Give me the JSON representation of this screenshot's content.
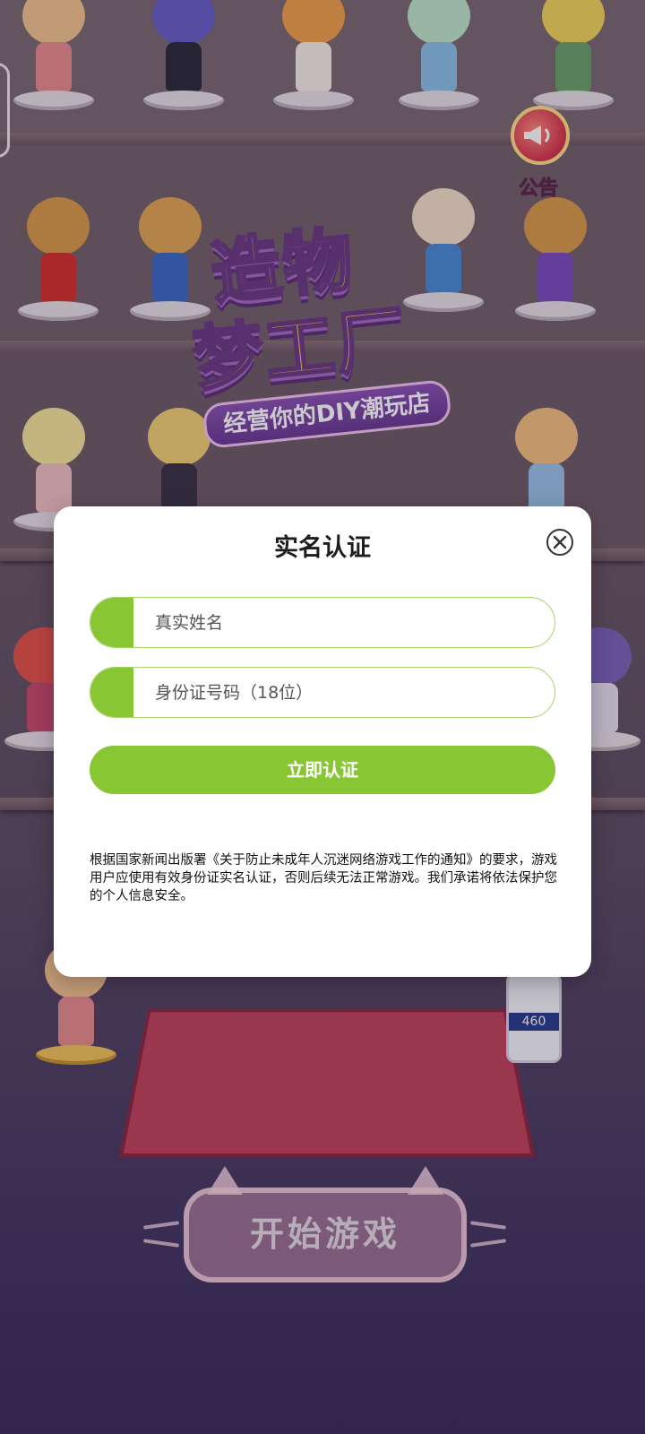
{
  "background": {
    "logo_line1": "造物",
    "logo_line2": "梦工厂",
    "logo_subtitle": "经营你的DIY潮玩店",
    "notice_label": "公告",
    "start_button": "开始游戏",
    "glue_label": "460"
  },
  "dialog": {
    "title": "实名认证",
    "name_placeholder": "真实姓名",
    "id_placeholder": "身份证号码（18位）",
    "submit_label": "立即认证",
    "notice": "根据国家新闻出版署《关于防止未成年人沉迷网络游戏工作的通知》的要求，游戏用户应使用有效身份证实名认证，否则后续无法正常游戏。我们承诺将依法保护您的个人信息安全。"
  },
  "colors": {
    "accent_green": "#88c634",
    "field_border": "#a7d36c"
  },
  "icons": {
    "close": "close-circle-icon",
    "notice": "megaphone-icon"
  }
}
